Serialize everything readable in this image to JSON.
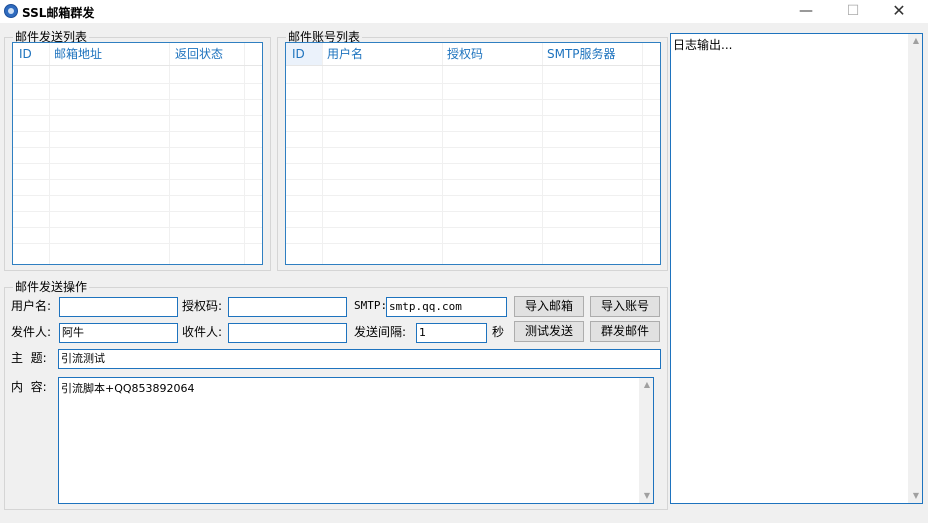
{
  "window": {
    "title": "SSL邮箱群发",
    "minimize_glyph": "—",
    "maximize_glyph": "☐",
    "close_glyph": "✕"
  },
  "send_list": {
    "title": "邮件发送列表",
    "columns": [
      "ID",
      "邮箱地址",
      "返回状态"
    ],
    "rows": []
  },
  "account_list": {
    "title": "邮件账号列表",
    "columns": [
      "ID",
      "用户名",
      "授权码",
      "SMTP服务器"
    ],
    "rows": []
  },
  "operation": {
    "title": "邮件发送操作",
    "username_label": "用户名:",
    "username_value": "",
    "authcode_label": "授权码:",
    "authcode_value": "",
    "smtp_label": "SMTP:",
    "smtp_value": "smtp.qq.com",
    "import_email_button": "导入邮箱",
    "import_account_button": "导入账号",
    "sender_label": "发件人:",
    "sender_value": "阿牛",
    "recipient_label": "收件人:",
    "recipient_value": "",
    "interval_label": "发送间隔:",
    "interval_value": "1",
    "interval_unit": "秒",
    "test_send_button": "测试发送",
    "mass_send_button": "群发邮件",
    "subject_label": "主  题:",
    "subject_value": "引流测试",
    "content_label": "内  容:",
    "content_value": "引流脚本+QQ853892064"
  },
  "log": {
    "text": "日志输出..."
  },
  "icons": {
    "app": "app-logo-icon",
    "scroll_up": "scroll-up-icon",
    "scroll_down": "scroll-down-icon"
  },
  "colors": {
    "accent": "#1e73be",
    "header_text": "#1e73be",
    "background": "#f0f0f0"
  }
}
